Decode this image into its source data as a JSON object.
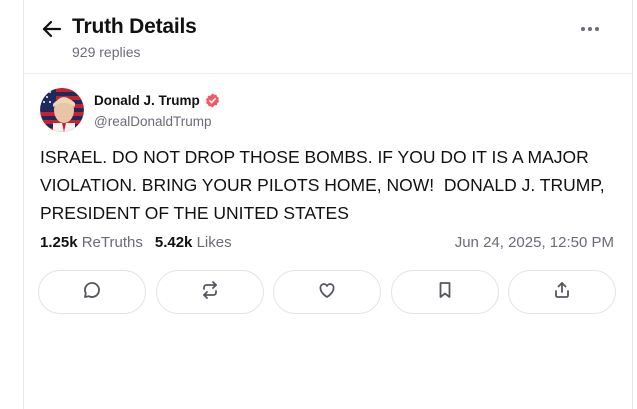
{
  "header": {
    "title": "Truth Details",
    "replies": "929 replies"
  },
  "post": {
    "author_name": "Donald J. Trump",
    "author_handle": "@realDonaldTrump",
    "verified_color": "#f15a6b",
    "text": "ISRAEL. DO NOT DROP THOSE BOMBS. IF YOU DO IT IS A MAJOR VIOLATION. BRING YOUR PILOTS HOME, NOW!  DONALD J. TRUMP, PRESIDENT OF THE UNITED STATES",
    "retruths_count": "1.25k",
    "retruths_label": "ReTruths",
    "likes_count": "5.42k",
    "likes_label": "Likes",
    "timestamp": "Jun 24, 2025, 12:50 PM"
  },
  "actions": [
    {
      "icon": "reply-icon"
    },
    {
      "icon": "retruth-icon"
    },
    {
      "icon": "like-icon"
    },
    {
      "icon": "bookmark-icon"
    },
    {
      "icon": "share-icon"
    }
  ],
  "colors": {
    "text": "#111111",
    "muted": "#6b6b78",
    "border": "#e3e3e8"
  }
}
